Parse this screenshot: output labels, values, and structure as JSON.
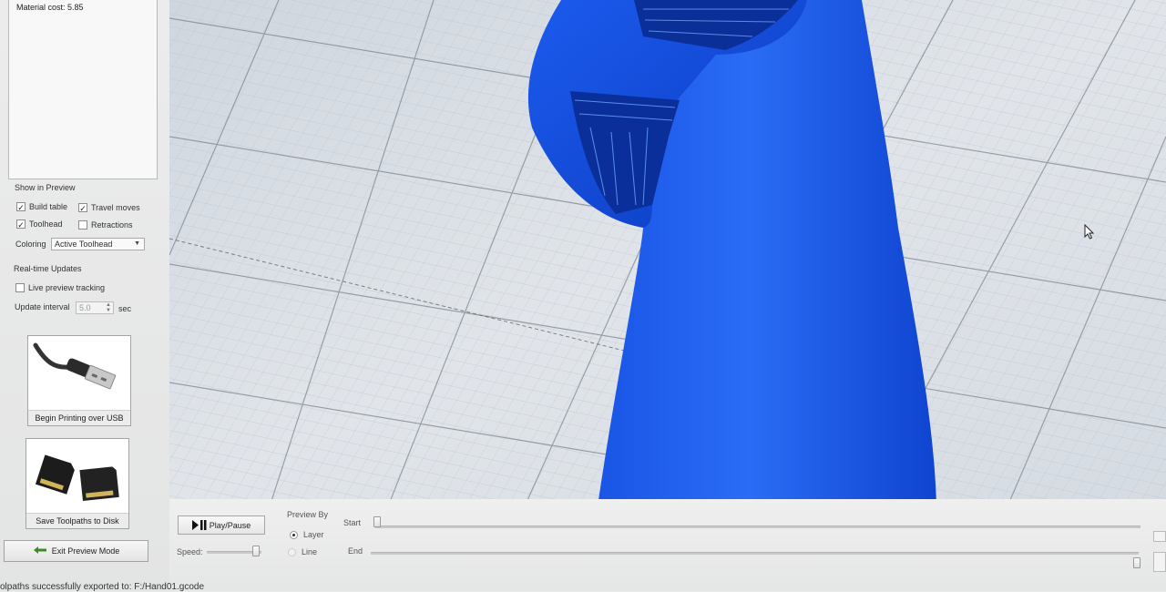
{
  "stats": {
    "material_cost": "Material cost: 5.85"
  },
  "show_in_preview": {
    "heading": "Show in Preview",
    "build_table": {
      "label": "Build table",
      "checked": true
    },
    "travel_moves": {
      "label": "Travel moves",
      "checked": true
    },
    "toolhead": {
      "label": "Toolhead",
      "checked": true
    },
    "retractions": {
      "label": "Retractions",
      "checked": false
    },
    "coloring_label": "Coloring",
    "coloring_value": "Active Toolhead"
  },
  "realtime": {
    "heading": "Real-time Updates",
    "live_preview": {
      "label": "Live preview tracking",
      "checked": false
    },
    "interval_label": "Update interval",
    "interval_value": "5.0",
    "interval_unit": "sec"
  },
  "actions": {
    "usb_label": "Begin Printing over USB",
    "disk_label": "Save Toolpaths to Disk",
    "exit_label": "Exit Preview Mode"
  },
  "controls": {
    "play_label": "Play/Pause",
    "speed_label": "Speed:",
    "preview_by_label": "Preview By",
    "layer_label": "Layer",
    "line_label": "Line",
    "start_label": "Start",
    "end_label": "End",
    "selected_mode": "Layer"
  },
  "status": {
    "message": "olpaths successfully exported to: F:/Hand01.gcode"
  },
  "colors": {
    "model_blue": "#1f63f0",
    "model_dark": "#0d3fc6",
    "grid_bg": "#d9dee4",
    "panel_bg": "#e8e8e8"
  },
  "icons": {
    "usb": "usb-cable-icon",
    "disk": "sd-cards-icon",
    "exit": "back-arrow-icon",
    "play": "play-pause-icon",
    "cursor": "mouse-pointer-icon"
  }
}
